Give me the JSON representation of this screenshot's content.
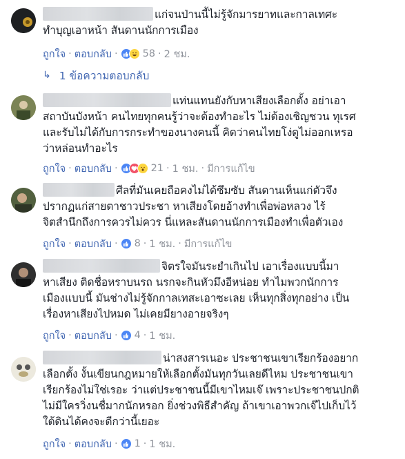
{
  "comments": [
    {
      "lines": [
        "แก่จนป่านนี้ไม่รู้จักมารยาทและกาลเทศะ",
        "ทำบุญเอาหน้า สันดานนักการเมือง"
      ],
      "like_label": "ถูกใจ",
      "reply_label": "ตอบกลับ",
      "reaction_count": "58",
      "time": "2 ชม.",
      "edited": "",
      "reactions": [
        "like",
        "haha"
      ],
      "replies_label": "1 ข้อความตอบกลับ"
    },
    {
      "lines": [
        "แท่นแทนยังกับหาเสียงเลือกตั้ง อย่าเอา",
        "สถาบันบังหน้า คนไทยทุกคนรู้ว่าจะต้องทำอะไร ไม่ต้องเชิญชวน ทุเรศ",
        "และรับไม่ได้กับการกระทำของนางคนนี้ คิดว่าคนไทยโง่ดูไม่ออกเหรอ",
        "ว่าหล่อนทำอะไร"
      ],
      "like_label": "ถูกใจ",
      "reply_label": "ตอบกลับ",
      "reaction_count": "21",
      "time": "1 ชม.",
      "edited": "มีการแก้ไข",
      "reactions": [
        "like",
        "love",
        "wow"
      ]
    },
    {
      "lines": [
        "ศีลที่มันเคยถือคงไม่ได้ซึมซับ สันดานเห็นแก่ตัวจึง",
        "ปรากฏแก่สายตาชาวประชา หาเสียงโดยอ้างทำเพื่อพ่อหลวง ไร้",
        "จิตสำนึกถึงการควรไม่ควร นี่แหละสันดานนักการเมืองทำเพื่อตัวเอง"
      ],
      "like_label": "ถูกใจ",
      "reply_label": "ตอบกลับ",
      "reaction_count": "8",
      "time": "1 ชม.",
      "edited": "มีการแก้ไข",
      "reactions": [
        "like"
      ]
    },
    {
      "lines": [
        "จิตรใจมันระยำเกินไป เอาเรื่องแบบนี้มา",
        "หาเสียง ติดชื่อหราบนรถ นรกจะกินหัวมึงอีหน่อย ทำไมพวกนักการ",
        "เมืองแบบนี้ มันช่างไม่รู้จักกาลเทสะเอาซะเลย เห็นทุกสิ่งทุกอย่าง เป็น",
        "เรื่องหาเสียงไปหมด ไม่เคยมียางอายจริงๆ"
      ],
      "like_label": "ถูกใจ",
      "reply_label": "ตอบกลับ",
      "reaction_count": "4",
      "time": "1 ชม.",
      "edited": "",
      "reactions": [
        "like"
      ]
    },
    {
      "lines": [
        "น่าสงสารเนอะ ประชาชนเขาเรียกร้องอยาก",
        "เลือกตั้ง งั้นเขียนกฎหมายให้เลือกตั้งมันทุกวันเลยดีไหม ประชาชนเขา",
        "เรียกร้องไม่ใช่เรอะ ว่าแต่ประชาชนนี้มีเขาไหมเจ๊ เพราะประชาชนปกติ",
        "ไม่มีใครวิ่งนชื่มากนักหรอก ยิ่งช่วงพิธีสำคัญ ถ้าเขาเอาพวกเจ๊ไปเก็บไว้",
        "ใต้ดินได้คงจะดีกว่านี้เยอะ"
      ],
      "like_label": "ถูกใจ",
      "reply_label": "ตอบกลับ",
      "reaction_count": "1",
      "time": "1 ชม.",
      "edited": "",
      "reactions": [
        "like"
      ]
    }
  ],
  "colors": {
    "link": "#4267b2",
    "meta": "#90949c",
    "text": "#1d2129",
    "like": "#4c86f5"
  }
}
